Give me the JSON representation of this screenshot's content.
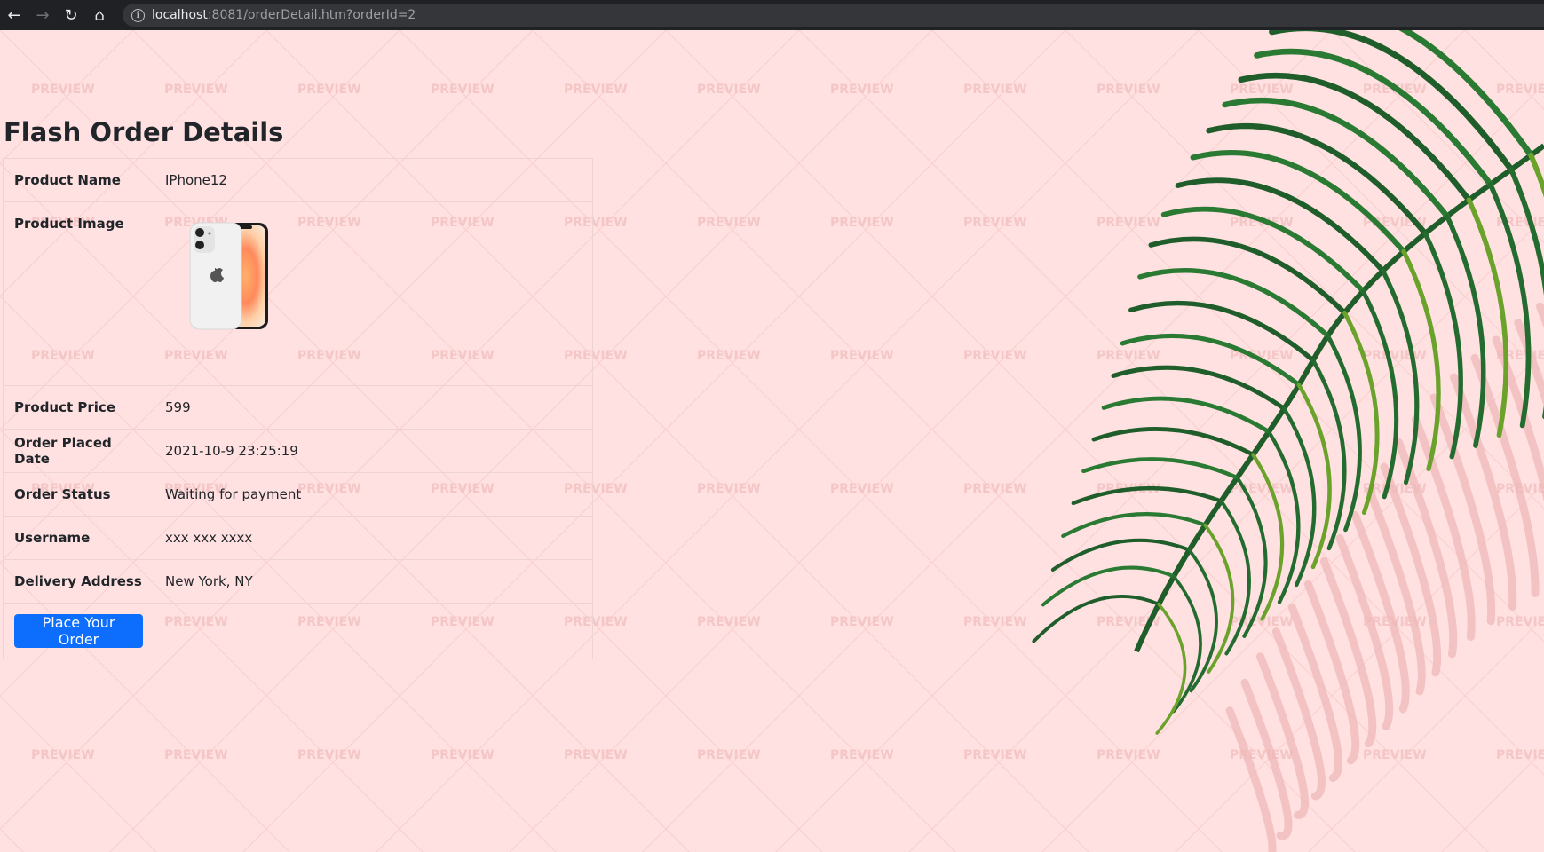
{
  "browser": {
    "url_host": "localhost",
    "url_rest": ":8081/orderDetail.htm?orderId=2"
  },
  "page": {
    "title": "Flash Order Details",
    "watermark_text": "PREVIEW",
    "rows": [
      {
        "label": "Product Name",
        "value": "IPhone12"
      },
      {
        "label": "Product Image",
        "value": ""
      },
      {
        "label": "Product Price",
        "value": "599"
      },
      {
        "label": "Order Placed Date",
        "value": "2021-10-9 23:25:19"
      },
      {
        "label": "Order Status",
        "value": "Waiting for payment"
      },
      {
        "label": "Username",
        "value": "xxx xxx xxxx"
      },
      {
        "label": "Delivery Address",
        "value": "New York, NY"
      }
    ],
    "order_button_label": "Place Your Order"
  },
  "colors": {
    "background": "#ffe1e1",
    "button": "#0d6efd",
    "leaf": "#1f5e2a"
  }
}
